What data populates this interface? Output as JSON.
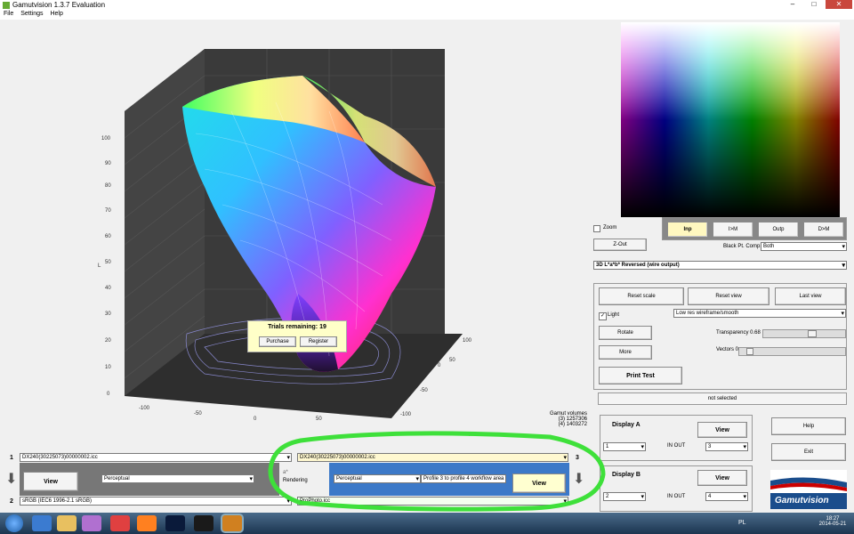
{
  "window": {
    "title": "Gamutvision 1.3.7  Evaluation"
  },
  "menu": [
    "File",
    "Settings",
    "Help"
  ],
  "plot": {
    "y_ticks": [
      "0",
      "10",
      "20",
      "30",
      "40",
      "50",
      "60",
      "70",
      "80",
      "90",
      "100"
    ],
    "x_ticks": [
      "-100",
      "-50",
      "0",
      "50",
      "100"
    ],
    "z_ticks": [
      "-100",
      "-50",
      "0",
      "50",
      "100"
    ],
    "y_label": "L",
    "x_label": "a*",
    "z_label": "b*"
  },
  "trial_dialog": {
    "message": "Trials remaining: 19",
    "purchase": "Purchase",
    "register": "Register"
  },
  "gamut": {
    "title": "Gamut volumes",
    "v3": "(3)  1257306",
    "v4": "(4)  1403272"
  },
  "right_panel": {
    "zoom": "Zoom",
    "zout": "Z-Out",
    "tabs": [
      "Inp",
      "I>M",
      "Outp",
      "D>M"
    ],
    "black_pt_label": "Black Pt. Comp.",
    "black_pt_value": "Both",
    "view_mode": "3D L*a*b* Reversed (wire output)",
    "reset_scale": "Reset scale",
    "reset_view": "Reset view",
    "last_view": "Last view",
    "light": "Light",
    "render_mode": "Low res wireframe/smooth",
    "rotate": "Rotate",
    "transparency": "Transparency 0.68",
    "more": "More",
    "vectors": "Vectors 0",
    "print_test": "Print Test",
    "status": "not selected",
    "display_a": "Display A",
    "display_b": "Display B",
    "view": "View",
    "in_out": "IN OUT",
    "a_in": "1",
    "a_out": "3",
    "b_in": "2",
    "b_out": "4",
    "help": "Help",
    "exit": "Exit",
    "logo": "Gamutvision"
  },
  "workflow": {
    "n1": "1",
    "n2": "2",
    "n3": "3",
    "n4": "4",
    "profile1": "DX240(30225073)00000002.icc",
    "profile2": "sRGB   (IEC6 1996-2.1 sRGB)",
    "profile3": "DX240(30225073)00000002.icc",
    "profile4": "ProPhoto.icc",
    "left_view": "View",
    "left_rendering": "Perceptual",
    "rendering_label": "Rendering",
    "small_label": "a*",
    "right_rendering": "Perceptual",
    "area_label": "Profile 3 to profile 4 workflow area",
    "right_view": "View"
  },
  "taskbar": {
    "lang": "PL",
    "time": "18:27",
    "date": "2014-05-21"
  }
}
